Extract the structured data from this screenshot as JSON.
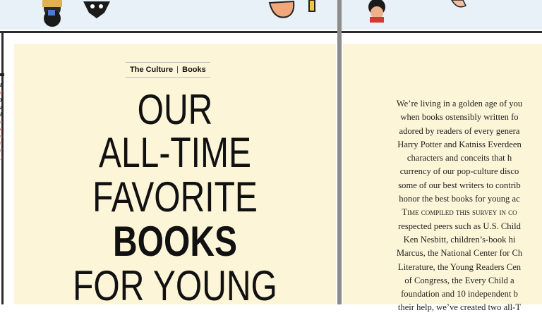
{
  "left_page": {
    "section_tag": {
      "section": "The Culture",
      "subsection": "Books"
    },
    "headline": [
      "OUR",
      "ALL-TIME",
      "FAVORITE",
      "BOOKS",
      "FOR YOUNG"
    ]
  },
  "prev_page_fragment": [
    "D",
    "d",
    "y",
    "a",
    "ll",
    "o",
    "e",
    "nt",
    "h",
    "d",
    ".\""
  ],
  "right_page": {
    "body_lines": [
      "We’re living in a golden age of you",
      "when books ostensibly written fo",
      "adored by readers of every genera",
      "Harry Potter and Katniss Everdeen",
      "characters and conceits that h",
      "currency of our pop-culture disco",
      "some of our best writers to contrib",
      "honor the best books for young ac",
      "Time compiled this survey in co",
      "respected peers such as U.S. Child",
      "Ken Nesbitt, children’s-book hi",
      "Marcus, the National Center for Ch",
      "Literature, the Young Readers Cen",
      "of Congress, the Every Child a",
      "foundation and 10 independent b",
      "their help, we’ve created two all-T"
    ]
  },
  "colors": {
    "page_bg": "#fdf5d8",
    "gutter": "#8c8c8c",
    "sky": "#e8f1f8"
  }
}
